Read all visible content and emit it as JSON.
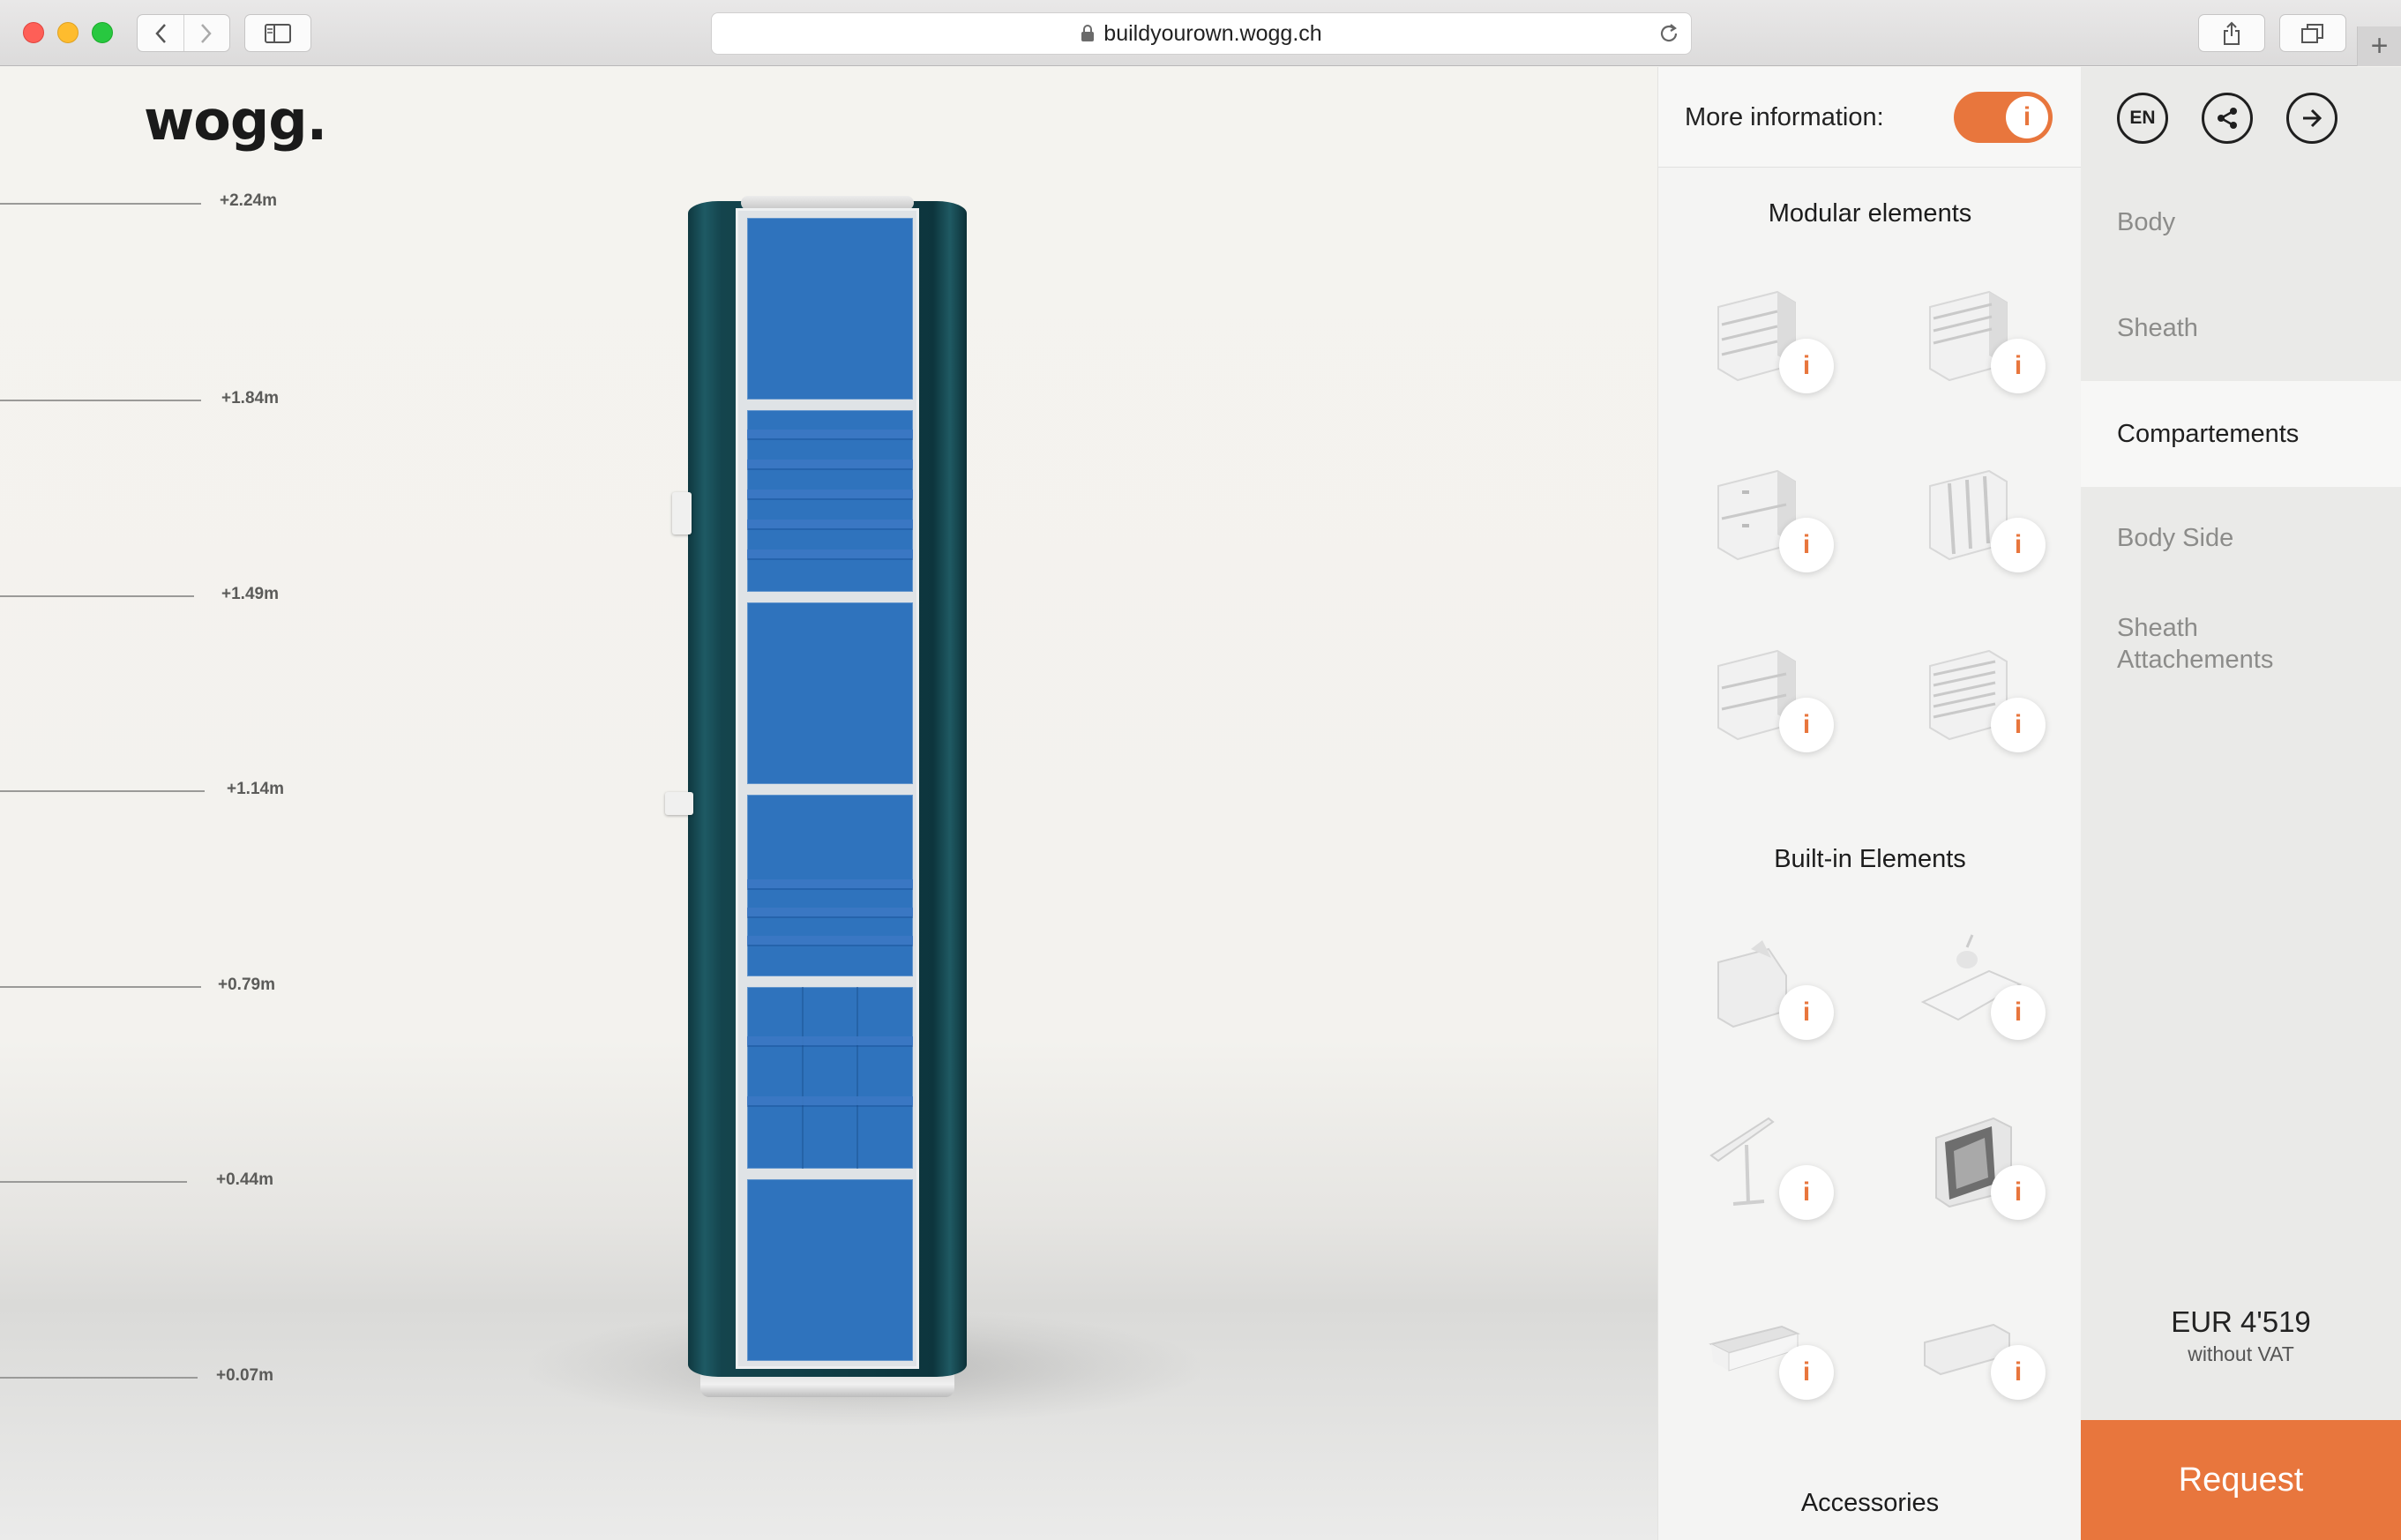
{
  "browser": {
    "url": "buildyourown.wogg.ch",
    "new_tab": "+"
  },
  "brand": {
    "logo": "wogg."
  },
  "ruler": [
    {
      "label": "+2.24m"
    },
    {
      "label": "+1.84m"
    },
    {
      "label": "+1.49m"
    },
    {
      "label": "+1.14m"
    },
    {
      "label": "+0.79m"
    },
    {
      "label": "+0.44m"
    },
    {
      "label": "+0.07m"
    }
  ],
  "panel": {
    "more_info_label": "More information:",
    "more_info_toggle": {
      "on": true,
      "icon_glyph": "i"
    },
    "sections": [
      {
        "title": "Modular elements"
      },
      {
        "title": "Built-in Elements"
      },
      {
        "title": "Accessories"
      }
    ],
    "info_glyph": "i"
  },
  "header_buttons": {
    "language": "EN",
    "share_icon": "share-icon",
    "next_icon": "arrow-right-icon"
  },
  "nav": {
    "items": [
      {
        "label": "Body"
      },
      {
        "label": "Sheath"
      },
      {
        "label": "Compartements",
        "active": true
      },
      {
        "label": "Body Side"
      },
      {
        "label": "Sheath Attachements"
      }
    ]
  },
  "price": {
    "amount": "EUR 4'519",
    "note": "without VAT"
  },
  "request_label": "Request",
  "colors": {
    "accent": "#e8763d",
    "cabinet_body": "#103d45",
    "compartment_blue": "#2f73bd"
  }
}
